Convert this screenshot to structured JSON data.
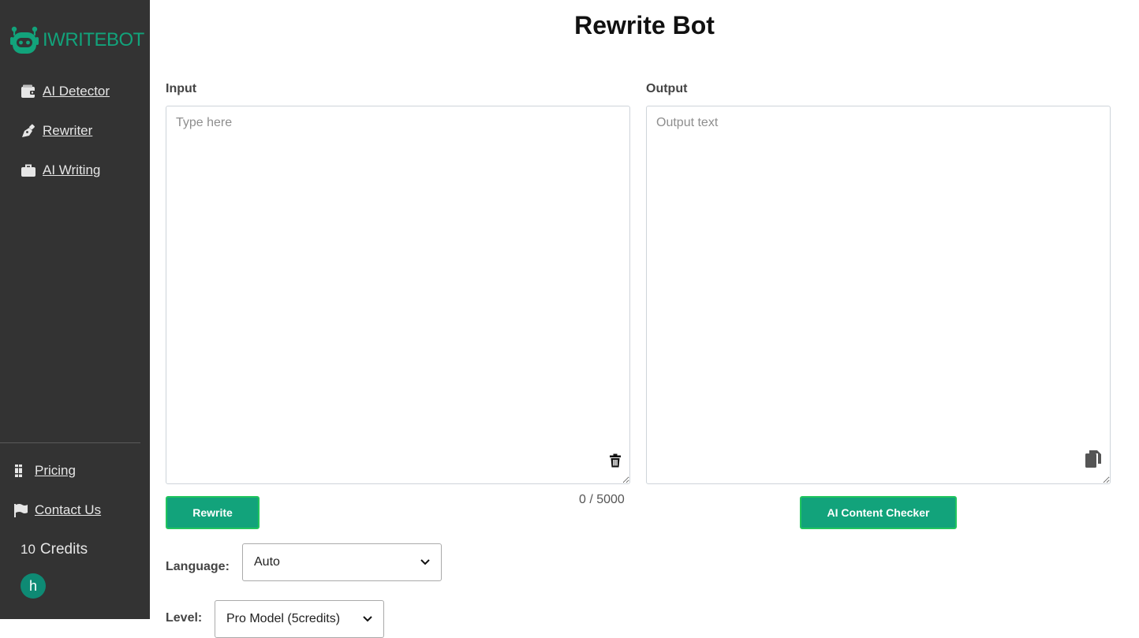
{
  "brand": {
    "name": "IWRITEBOT",
    "color": "#12a37b"
  },
  "sidebar": {
    "nav": [
      {
        "label": "AI Detector",
        "icon": "wallet-icon"
      },
      {
        "label": "Rewriter",
        "icon": "pen-nib-icon"
      },
      {
        "label": "AI Writing",
        "icon": "briefcase-icon"
      }
    ],
    "bottom": [
      {
        "label": "Pricing",
        "icon": "books-icon"
      },
      {
        "label": "Contact Us",
        "icon": "flag-icon"
      }
    ],
    "credits": {
      "count": "10",
      "label": "Credits"
    },
    "avatar_initial": "h"
  },
  "main": {
    "title": "Rewrite Bot",
    "input": {
      "label": "Input",
      "placeholder": "Type here",
      "counter": "0 / 5000"
    },
    "output": {
      "label": "Output",
      "placeholder": "Output text"
    },
    "buttons": {
      "rewrite": "Rewrite",
      "checker": "AI Content Checker"
    },
    "language": {
      "label": "Language:",
      "value": "Auto"
    },
    "model": {
      "label": "Level:",
      "value": "Pro Model (5credits)"
    }
  }
}
